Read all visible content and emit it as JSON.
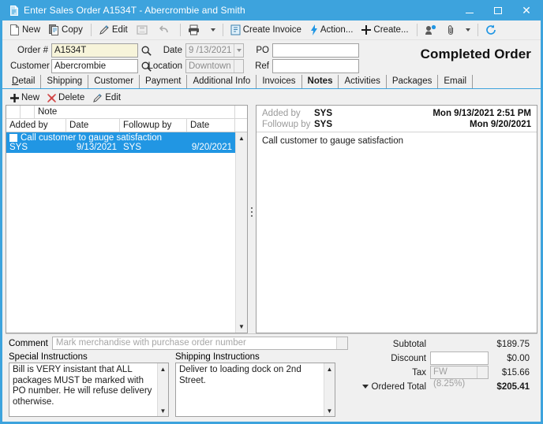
{
  "window": {
    "title": "Enter Sales Order A1534T - Abercrombie and Smith",
    "icon": "document-icon",
    "controls": {
      "minimize": "minimize-icon",
      "maximize": "maximize-icon",
      "close": "close-icon"
    },
    "accent_color": "#3da3dd",
    "selection_color": "#2196e3"
  },
  "toolbar": {
    "new_label": "New",
    "copy_label": "Copy",
    "edit_label": "Edit",
    "save_label": "",
    "undo_label": "",
    "print_label": "",
    "create_invoice_label": "Create Invoice",
    "action_label": "Action...",
    "create_label": "Create...",
    "contact_label": "",
    "attach_label": "",
    "refresh_label": ""
  },
  "header": {
    "order_label": "Order #",
    "order_value": "A1534T",
    "customer_label": "Customer",
    "customer_value": "Abercrombie",
    "date_label": "Date",
    "date_value": "9 /13/2021",
    "location_label": "Location",
    "location_value": "Downtown",
    "po_label": "PO",
    "po_value": "",
    "ref_label": "Ref",
    "ref_value": "",
    "status_banner": "Completed Order"
  },
  "tabs": [
    {
      "label": "Detail",
      "active": false
    },
    {
      "label": "Shipping",
      "active": false
    },
    {
      "label": "Customer",
      "active": false
    },
    {
      "label": "Payment",
      "active": false
    },
    {
      "label": "Additional Info",
      "active": false
    },
    {
      "label": "Invoices",
      "active": false
    },
    {
      "label": "Notes",
      "active": true
    },
    {
      "label": "Activities",
      "active": false
    },
    {
      "label": "Packages",
      "active": false
    },
    {
      "label": "Email",
      "active": false
    }
  ],
  "notes_toolbar": {
    "new_label": "New",
    "delete_label": "Delete",
    "edit_label": "Edit"
  },
  "notes_grid": {
    "group_header": "Note",
    "columns": [
      "Added by",
      "Date",
      "Followup by",
      "Date"
    ],
    "rows": [
      {
        "checked": false,
        "note": "Call customer to gauge satisfaction",
        "added_by": "SYS",
        "added_date": "9/13/2021",
        "followup_by": "SYS",
        "followup_date": "9/20/2021",
        "selected": true
      }
    ]
  },
  "note_detail": {
    "added_by_label": "Added by",
    "added_by_value": "SYS",
    "added_on": "Mon 9/13/2021 2:51 PM",
    "followup_by_label": "Followup by",
    "followup_by_value": "SYS",
    "followup_on": "Mon 9/20/2021",
    "body": "Call customer to gauge satisfaction"
  },
  "bottom": {
    "comment_label": "Comment",
    "comment_placeholder": "Mark merchandise with purchase order number",
    "special_instructions_label": "Special Instructions",
    "special_instructions_value": "Bill is VERY insistant that ALL packages MUST be marked with PO number.  He will refuse delivery otherwise.",
    "shipping_instructions_label": "Shipping Instructions",
    "shipping_instructions_value": "Deliver to loading dock on 2nd Street."
  },
  "totals": {
    "subtotal_label": "Subtotal",
    "subtotal_value": "$189.75",
    "discount_label": "Discount",
    "discount_input": "",
    "discount_value": "$0.00",
    "tax_label": "Tax",
    "tax_input": "FW (8.25%)",
    "tax_value": "$15.66",
    "ordered_total_label": "Ordered Total",
    "ordered_total_value": "$205.41"
  }
}
